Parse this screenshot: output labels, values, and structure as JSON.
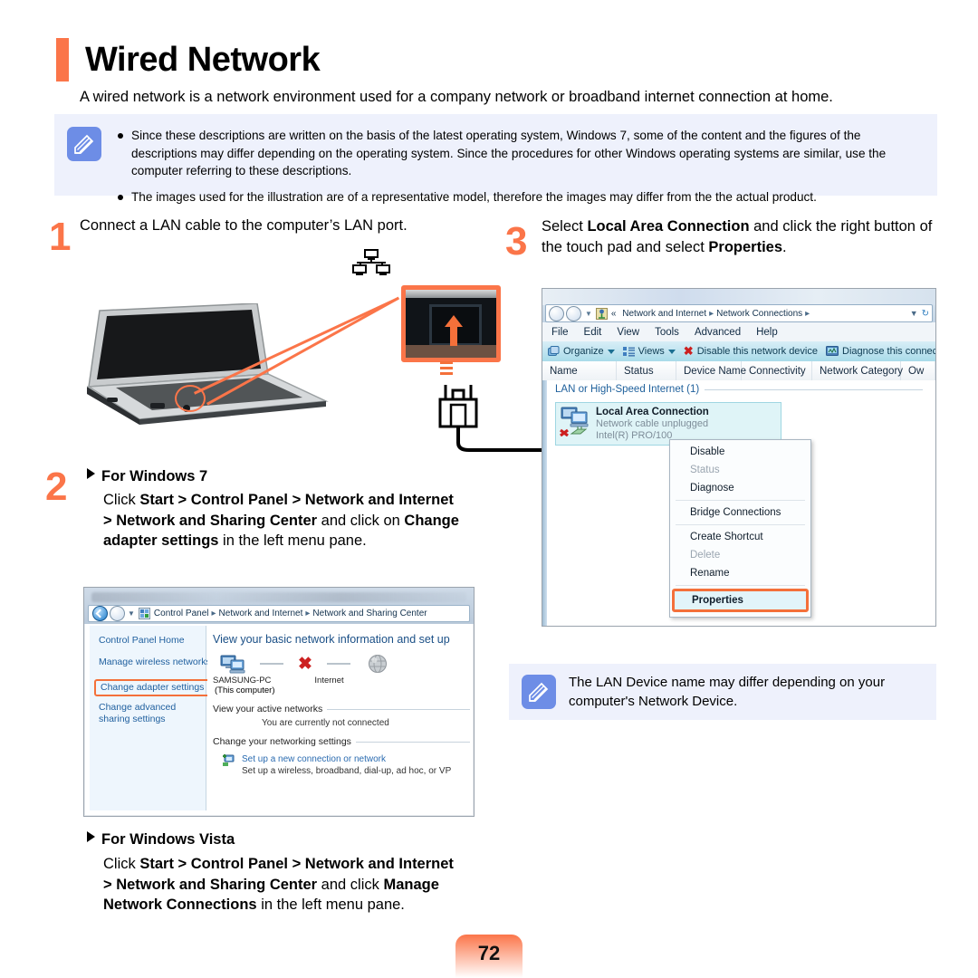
{
  "page": {
    "title": "Wired Network",
    "intro": "A wired network is a network environment used for a company network or broadband internet connection at home.",
    "number": "72",
    "accent_color": "#fb7549",
    "note_bg_color": "#eef1fc",
    "note_icon_color": "#6d8de6"
  },
  "note_top": {
    "icon": "pencil-note-icon",
    "bullets": [
      "Since these descriptions are written on the basis of the latest operating system, Windows 7, some of the content and the figures of the descriptions may differ depending on the operating system. Since the procedures for other Windows operating systems are similar, use the computer referring to these descriptions.",
      "The images used for the illustration are of a representative model, therefore the images may differ from the the actual product."
    ]
  },
  "note_right": {
    "icon": "pencil-note-icon",
    "text": "The LAN Device name may differ depending on your computer's Network Device."
  },
  "steps": {
    "one": {
      "number": "1",
      "text": "Connect a LAN cable to the computer’s LAN port."
    },
    "two": {
      "number": "2",
      "heading": "For Windows 7",
      "body_prefix": "Click ",
      "body_b1": "Start > Control Panel > Network and Internet > Network and Sharing Center",
      "body_mid": " and click on ",
      "body_b2": "Change adapter settings",
      "body_suffix": " in the left menu pane."
    },
    "three": {
      "number": "3",
      "prefix": "Select ",
      "b1": "Local Area Connection",
      "mid": " and click the right button of the touch pad and select ",
      "b2": "Properties",
      "suffix": "."
    },
    "vista": {
      "heading": "For Windows Vista",
      "body_prefix": "Click ",
      "body_b1": "Start > Control Panel > Network and Internet > Network and Sharing Center",
      "body_mid": " and click ",
      "body_b2": "Manage Network Connections",
      "body_suffix": " in the left menu pane."
    }
  },
  "illustration": {
    "lan_port_icon": "lan-port-icon",
    "rj45_plug_icon": "rj45-plug-icon",
    "laptop_icon": "laptop-icon",
    "callout_highlight": "lan-port-callout"
  },
  "ns_center_window": {
    "breadcrumb": [
      "Control Panel",
      "Network and Internet",
      "Network and Sharing Center"
    ],
    "sidebar": [
      {
        "label": "Control Panel Home",
        "highlighted": false
      },
      {
        "label": "Manage wireless networks",
        "highlighted": false
      },
      {
        "label": "Change adapter settings",
        "highlighted": true
      },
      {
        "label": "Change advanced sharing settings",
        "highlighted": false
      }
    ],
    "heading": "View your basic network information and set up",
    "diagram": {
      "computer_label": "SAMSUNG-PC",
      "computer_sublabel": "(This computer)",
      "internet_label": "Internet",
      "link_status_icon": "red-x-icon"
    },
    "section_active": "View your active networks",
    "active_status": "You are currently not connected",
    "section_change": "Change your networking settings",
    "setup_link": "Set up a new connection or network",
    "setup_desc": "Set up a wireless, broadband, dial-up, ad hoc, or VP"
  },
  "net_conn_window": {
    "breadcrumb_prefix": "«",
    "breadcrumb": [
      "Network and Internet",
      "Network Connections"
    ],
    "menus": [
      "File",
      "Edit",
      "View",
      "Tools",
      "Advanced",
      "Help"
    ],
    "toolbar": [
      {
        "label": "Organize",
        "icon": "organize-icon",
        "caret": true
      },
      {
        "label": "Views",
        "icon": "views-icon",
        "caret": true
      },
      {
        "label": "Disable this network device",
        "icon": "red-x-icon",
        "caret": false
      },
      {
        "label": "Diagnose this connec",
        "icon": "diagnose-icon",
        "caret": false
      }
    ],
    "columns": [
      "Name",
      "Status",
      "Device Name",
      "Connectivity",
      "Network Category",
      "Ow"
    ],
    "group_label": "LAN or High-Speed Internet (1)",
    "connection": {
      "name": "Local Area Connection",
      "status": "Network cable unplugged",
      "device": "Intel(R) PRO/100",
      "icon": "network-adapter-icon",
      "disabled_icon": "red-x-icon"
    },
    "context_menu": [
      {
        "label": "Disable",
        "disabled": false,
        "bold": false,
        "highlighted": false
      },
      {
        "label": "Status",
        "disabled": true,
        "bold": false,
        "highlighted": false
      },
      {
        "label": "Diagnose",
        "disabled": false,
        "bold": false,
        "highlighted": false
      },
      {
        "label": "Bridge Connections",
        "disabled": false,
        "bold": false,
        "highlighted": false
      },
      {
        "label": "Create Shortcut",
        "disabled": false,
        "bold": false,
        "highlighted": false
      },
      {
        "label": "Delete",
        "disabled": true,
        "bold": false,
        "highlighted": false
      },
      {
        "label": "Rename",
        "disabled": false,
        "bold": false,
        "highlighted": false
      },
      {
        "label": "Properties",
        "disabled": false,
        "bold": true,
        "highlighted": true
      }
    ]
  }
}
